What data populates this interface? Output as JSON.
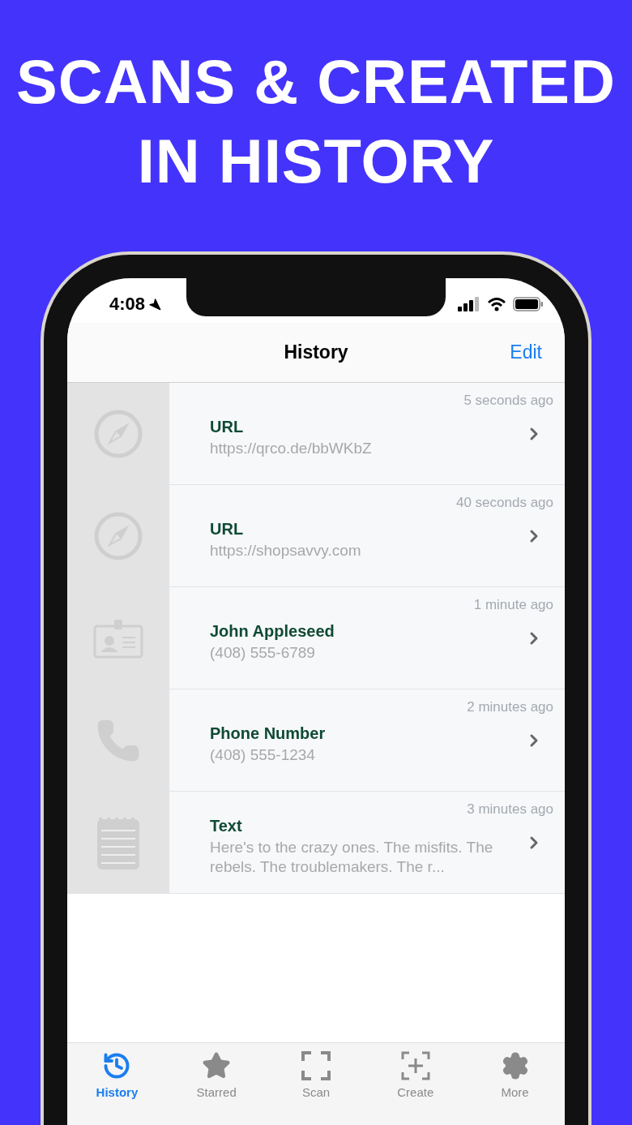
{
  "headline": [
    "SCANS & CREATED",
    "IN HISTORY"
  ],
  "status_bar": {
    "time": "4:08"
  },
  "nav": {
    "title": "History",
    "action": "Edit"
  },
  "rows": [
    {
      "kind": "compass",
      "time": "5 seconds ago",
      "title": "URL",
      "subtitle": "https://qrco.de/bbWKbZ"
    },
    {
      "kind": "compass",
      "time": "40 seconds ago",
      "title": "URL",
      "subtitle": "https://shopsavvy.com"
    },
    {
      "kind": "contact",
      "time": "1 minute ago",
      "title": "John Appleseed",
      "subtitle": "(408) 555-6789"
    },
    {
      "kind": "phone",
      "time": "2 minutes ago",
      "title": "Phone Number",
      "subtitle": "(408) 555-1234"
    },
    {
      "kind": "note",
      "time": "3 minutes ago",
      "title": "Text",
      "subtitle": "Here's to the crazy ones. The misfits. The rebels. The troublemakers. The r..."
    }
  ],
  "tabs": [
    {
      "kind": "history",
      "label": "History",
      "selected": true
    },
    {
      "kind": "star",
      "label": "Starred",
      "selected": false
    },
    {
      "kind": "scan",
      "label": "Scan",
      "selected": false
    },
    {
      "kind": "create",
      "label": "Create",
      "selected": false
    },
    {
      "kind": "gear",
      "label": "More",
      "selected": false
    }
  ]
}
